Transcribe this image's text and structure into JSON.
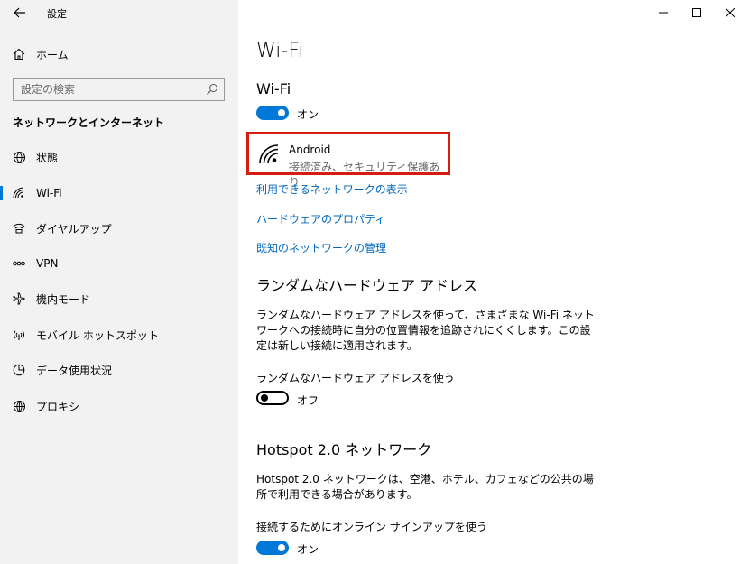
{
  "window": {
    "app_title": "設定"
  },
  "sidebar": {
    "home_label": "ホーム",
    "search_placeholder": "設定の検索",
    "section_heading": "ネットワークとインターネット",
    "items": [
      {
        "label": "状態",
        "icon": "globe-status-icon"
      },
      {
        "label": "Wi-Fi",
        "icon": "wifi-icon",
        "active": true
      },
      {
        "label": "ダイヤルアップ",
        "icon": "dialup-icon"
      },
      {
        "label": "VPN",
        "icon": "vpn-icon"
      },
      {
        "label": "機内モード",
        "icon": "airplane-icon"
      },
      {
        "label": "モバイル ホットスポット",
        "icon": "hotspot-icon"
      },
      {
        "label": "データ使用状況",
        "icon": "data-usage-icon"
      },
      {
        "label": "プロキシ",
        "icon": "globe-icon"
      }
    ]
  },
  "main": {
    "page_title": "Wi-Fi",
    "wifi_section_title": "Wi-Fi",
    "wifi_toggle_label": "オン",
    "network": {
      "name": "Android",
      "status": "接続済み、セキュリティ保護あり"
    },
    "links": [
      "利用できるネットワークの表示",
      "ハードウェアのプロパティ",
      "既知のネットワークの管理"
    ],
    "random_hw": {
      "title": "ランダムなハードウェア アドレス",
      "description": "ランダムなハードウェア アドレスを使って、さまざまな Wi-Fi ネットワークへの接続時に自分の位置情報を追跡されにくくします。この設定は新しい接続に適用されます。",
      "toggle_caption": "ランダムなハードウェア アドレスを使う",
      "toggle_label": "オフ"
    },
    "hotspot": {
      "title": "Hotspot 2.0 ネットワーク",
      "description": "Hotspot 2.0 ネットワークは、空港、ホテル、カフェなどの公共の場所で利用できる場合があります。",
      "toggle_caption": "接続するためにオンライン サインアップを使う",
      "toggle_label": "オン"
    }
  },
  "colors": {
    "accent": "#0078d7",
    "link": "#0067c0",
    "highlight_border": "#d61c0f",
    "sidebar_bg": "#f2f2f2"
  }
}
